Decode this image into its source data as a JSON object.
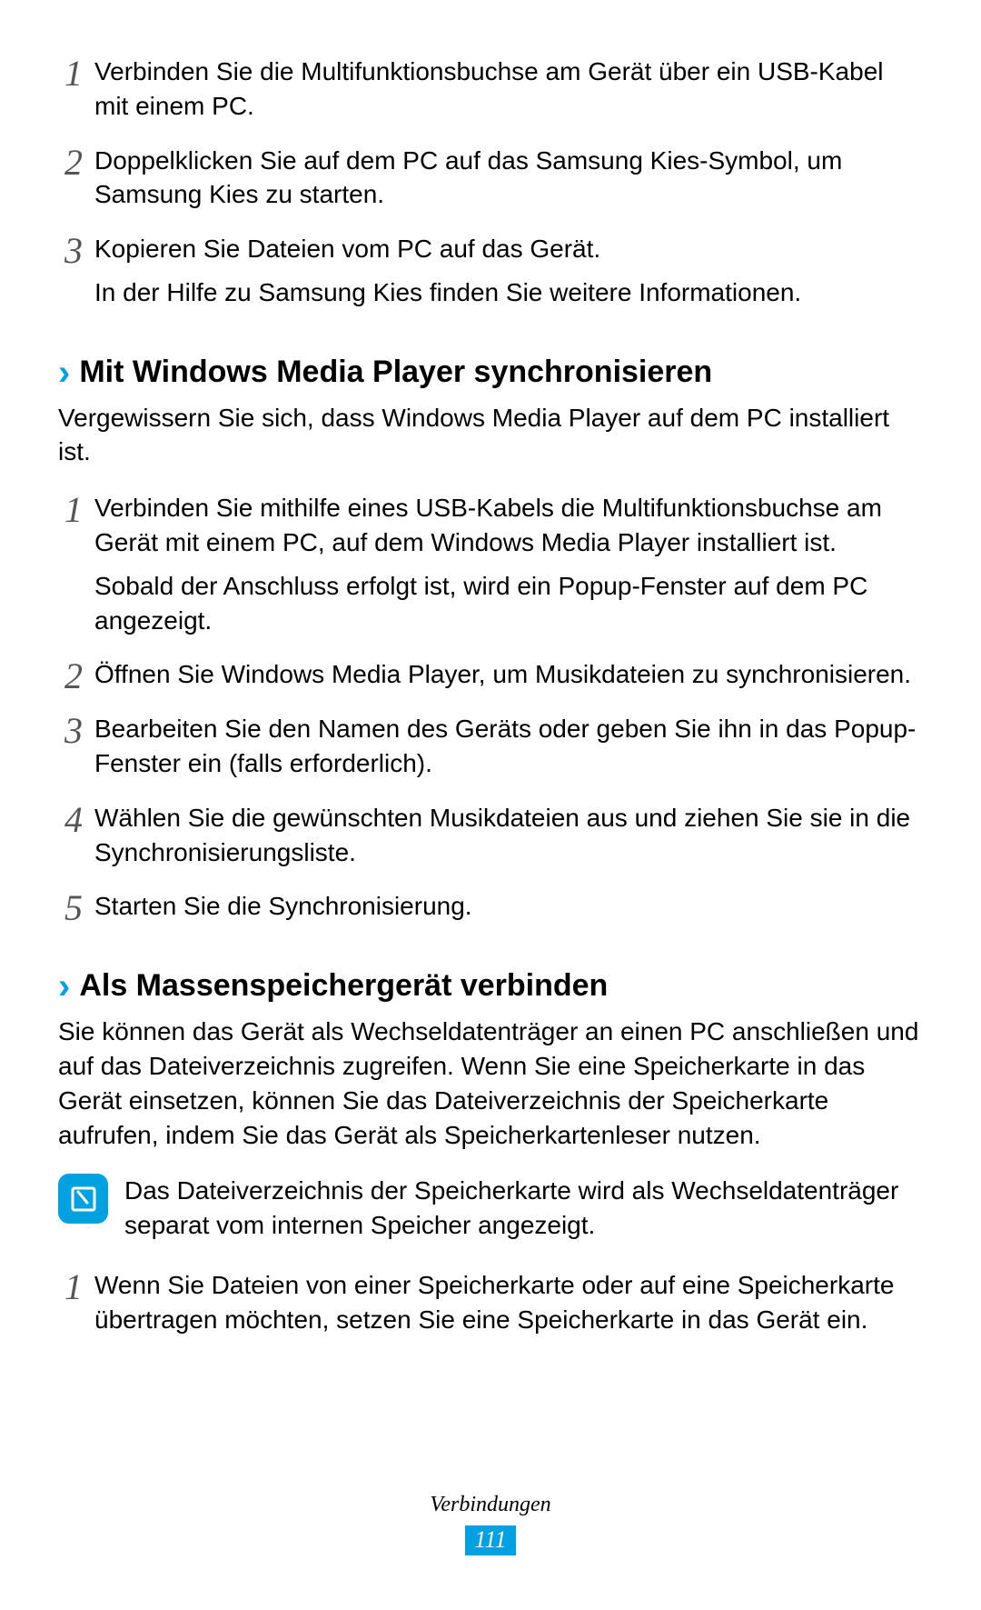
{
  "listA": [
    {
      "n": "1",
      "text": "Verbinden Sie die Multifunktionsbuchse am Gerät über ein USB-Kabel mit einem PC."
    },
    {
      "n": "2",
      "text": "Doppelklicken Sie auf dem PC auf das Samsung Kies-Symbol, um Samsung Kies zu starten."
    },
    {
      "n": "3",
      "text": "Kopieren Sie Dateien vom PC auf das Gerät.",
      "text2": "In der Hilfe zu Samsung Kies finden Sie weitere Informationen."
    }
  ],
  "section1": {
    "title": "Mit Windows Media Player synchronisieren",
    "intro": "Vergewissern Sie sich, dass Windows Media Player auf dem PC installiert ist.",
    "steps": [
      {
        "n": "1",
        "text": "Verbinden Sie mithilfe eines USB-Kabels die Multifunktionsbuchse am Gerät mit einem PC, auf dem Windows Media Player installiert ist.",
        "text2": "Sobald der Anschluss erfolgt ist, wird ein Popup-Fenster auf dem PC angezeigt."
      },
      {
        "n": "2",
        "text": "Öffnen Sie Windows Media Player, um Musikdateien zu synchronisieren."
      },
      {
        "n": "3",
        "text": "Bearbeiten Sie den Namen des Geräts oder geben Sie ihn in das Popup-Fenster ein (falls erforderlich)."
      },
      {
        "n": "4",
        "text": "Wählen Sie die gewünschten Musikdateien aus und ziehen Sie sie in die Synchronisierungsliste."
      },
      {
        "n": "5",
        "text": "Starten Sie die Synchronisierung."
      }
    ]
  },
  "section2": {
    "title": "Als Massenspeichergerät verbinden",
    "intro": "Sie können das Gerät als Wechseldatenträger an einen PC anschließen und auf das Dateiverzeichnis zugreifen. Wenn Sie eine Speicherkarte in das Gerät einsetzen, können Sie das Dateiverzeichnis der Speicherkarte aufrufen, indem Sie das Gerät als Speicherkartenleser nutzen.",
    "note": "Das Dateiverzeichnis der Speicherkarte wird als Wechseldatenträger separat vom internen Speicher angezeigt.",
    "steps": [
      {
        "n": "1",
        "text": "Wenn Sie Dateien von einer Speicherkarte oder auf eine Speicherkarte übertragen möchten, setzen Sie eine Speicherkarte in das Gerät ein."
      }
    ]
  },
  "footer": {
    "label": "Verbindungen",
    "page": "111"
  }
}
